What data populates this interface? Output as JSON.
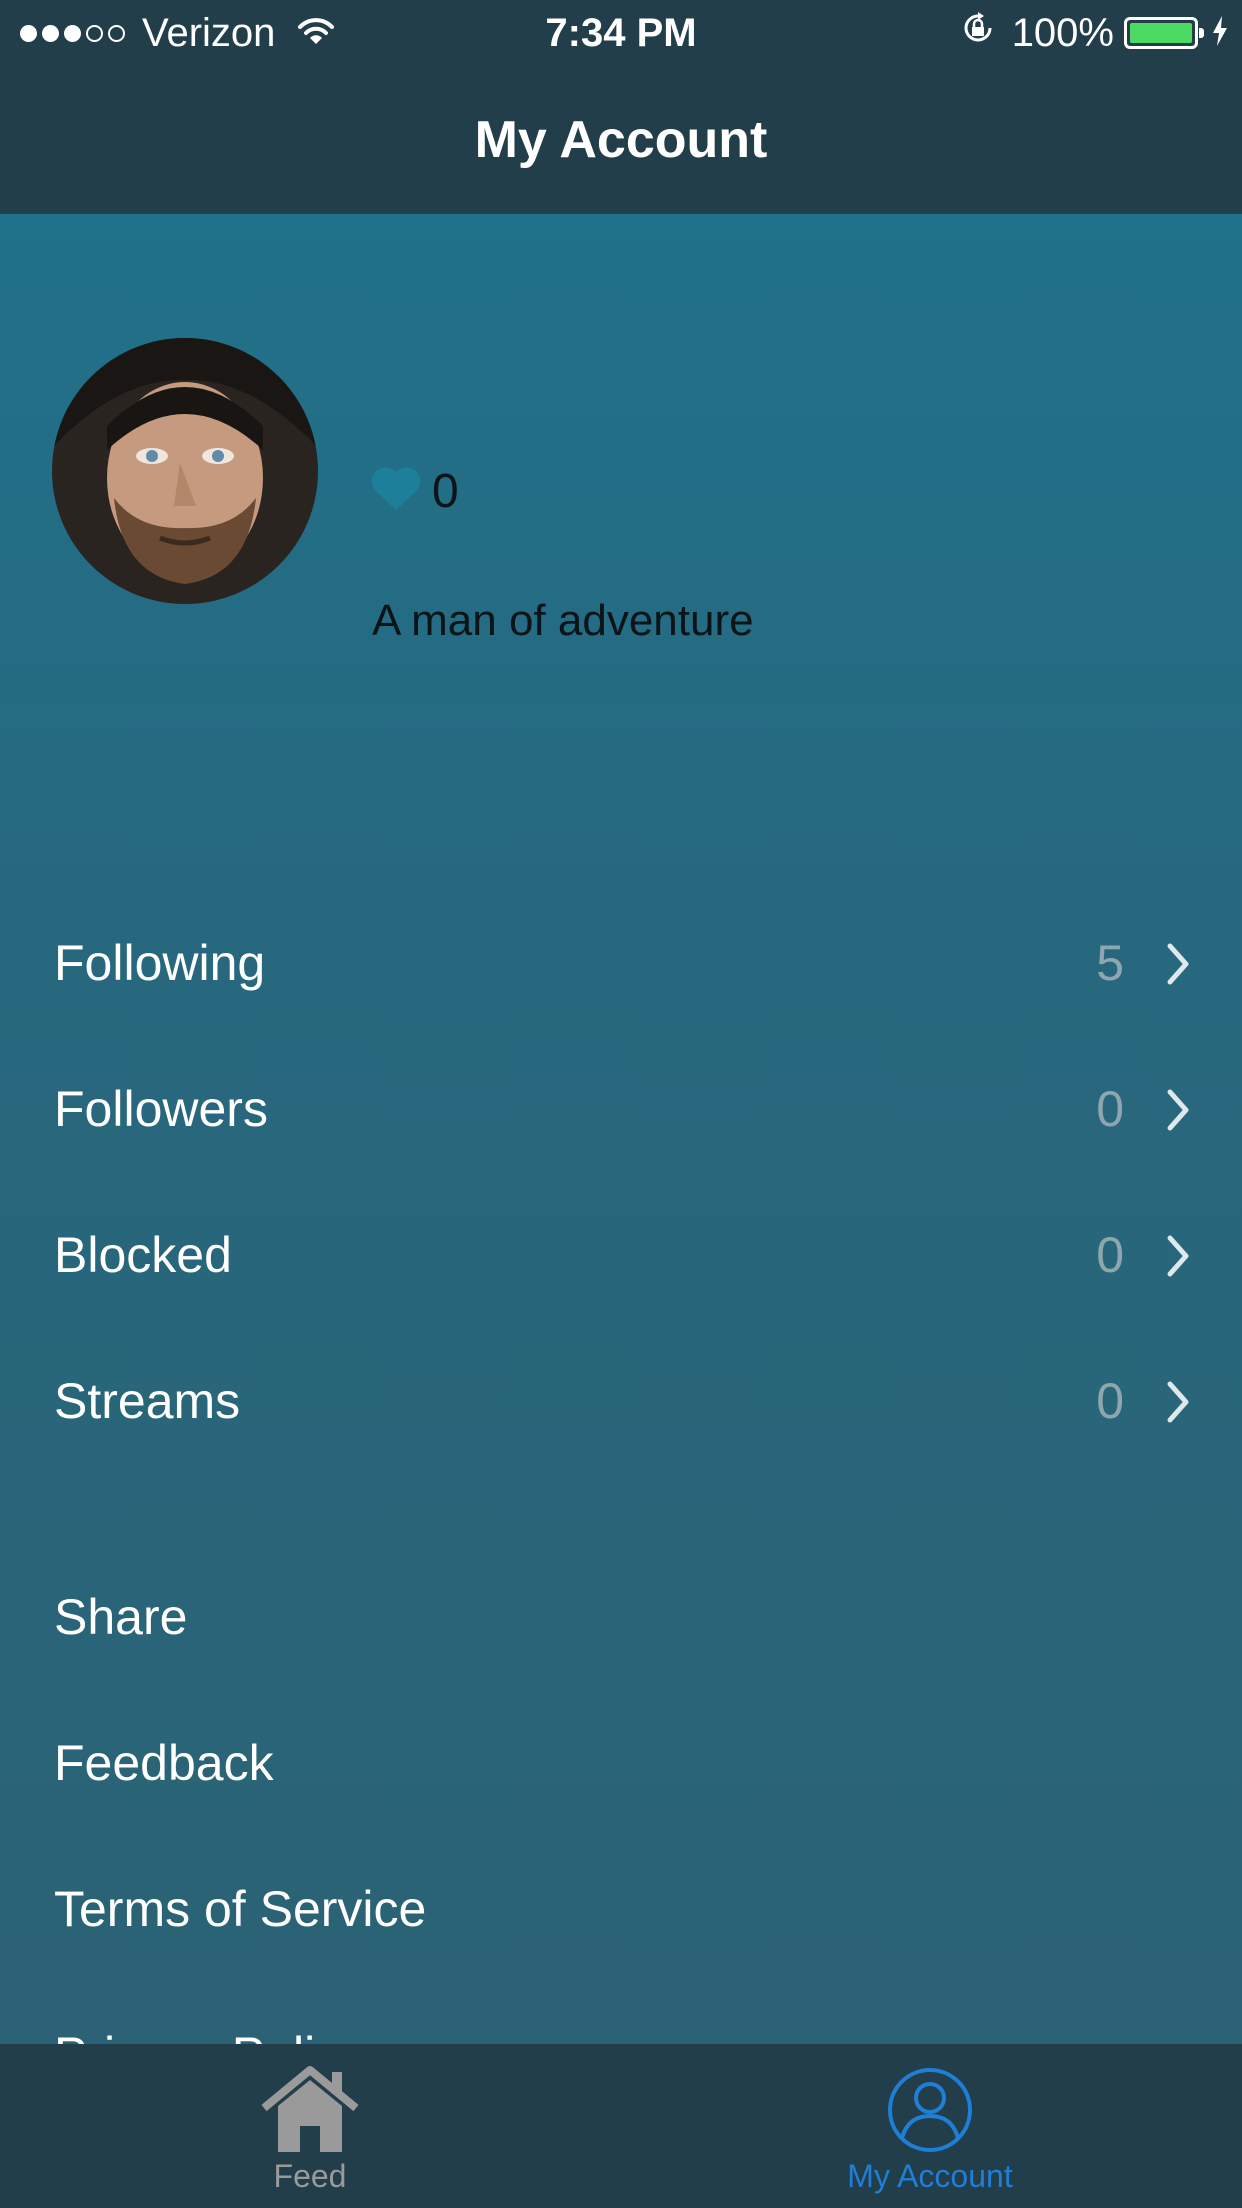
{
  "status_bar": {
    "carrier": "Verizon",
    "time": "7:34 PM",
    "battery": "100%",
    "signal_bars_filled": 3,
    "signal_bars_total": 5,
    "battery_level": 1.0
  },
  "nav": {
    "title": "My Account"
  },
  "profile": {
    "likes": "0",
    "bio": "A man of adventure"
  },
  "stats": [
    {
      "label": "Following",
      "count": "5"
    },
    {
      "label": "Followers",
      "count": "0"
    },
    {
      "label": "Blocked",
      "count": "0"
    },
    {
      "label": "Streams",
      "count": "0"
    }
  ],
  "links": [
    {
      "label": "Share"
    },
    {
      "label": "Feedback"
    },
    {
      "label": "Terms of Service"
    },
    {
      "label": "Privacy Policy"
    }
  ],
  "tabs": [
    {
      "label": "Feed",
      "icon": "home-icon",
      "selected": false
    },
    {
      "label": "My Account",
      "icon": "person-icon",
      "selected": true
    }
  ],
  "colors": {
    "header": "#233e4b",
    "accent": "#1f7ed6",
    "heart": "#1d7f99",
    "battery": "#4cd964"
  }
}
